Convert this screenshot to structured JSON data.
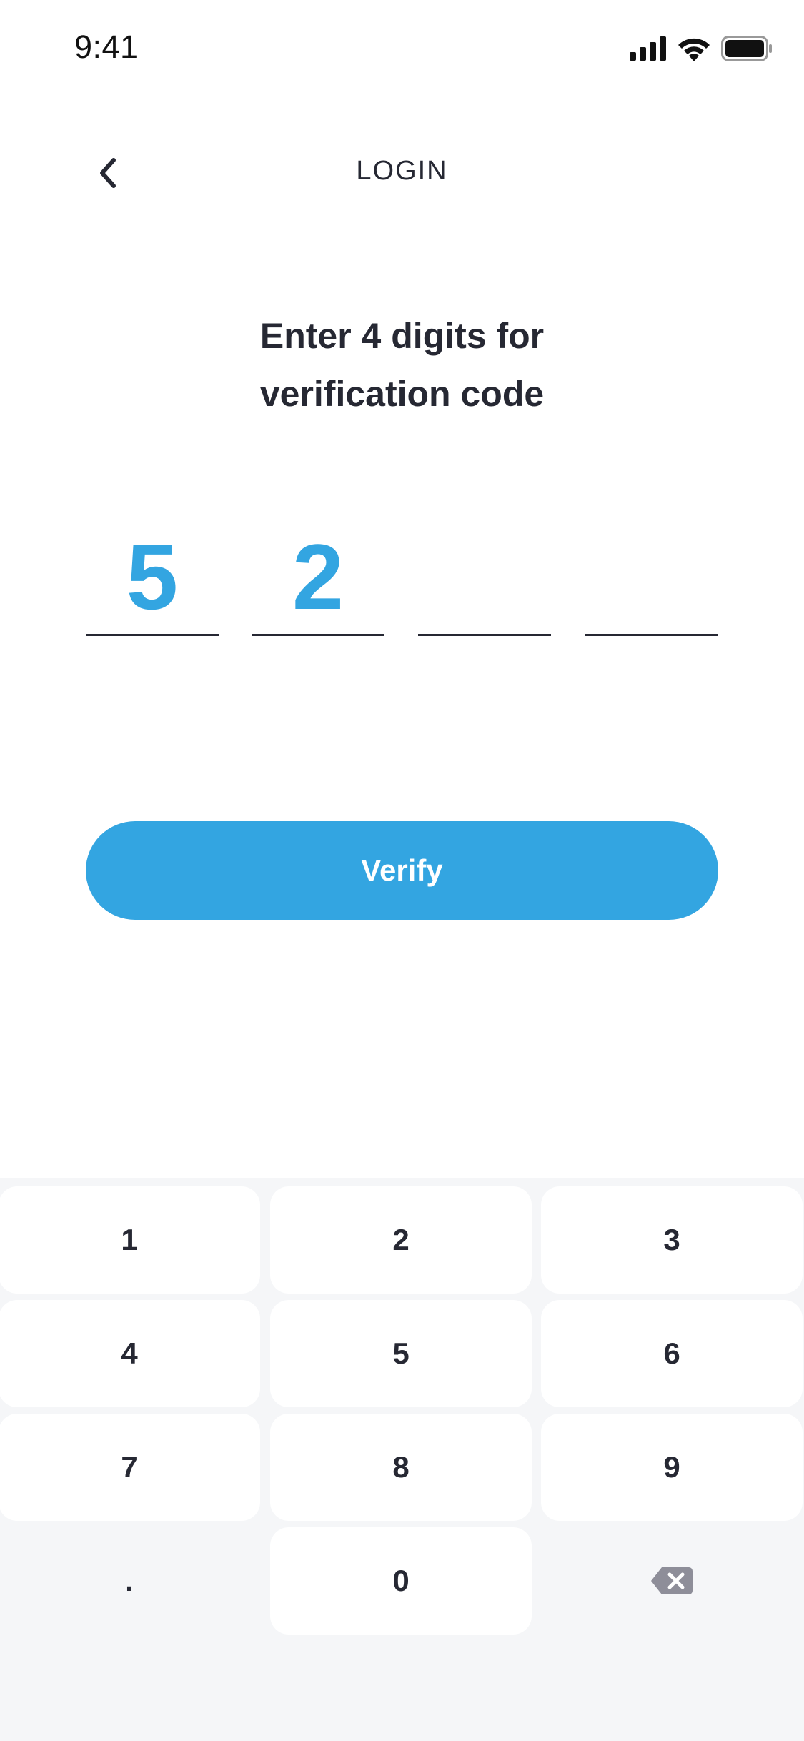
{
  "status_bar": {
    "time": "9:41",
    "icons": [
      "signal-icon",
      "wifi-icon",
      "battery-icon"
    ]
  },
  "header": {
    "back_icon": "chevron-left-icon",
    "title": "LOGIN"
  },
  "prompt": {
    "line1": "Enter 4 digits for",
    "line2": "verification code"
  },
  "code": {
    "length": 4,
    "digits": [
      "5",
      "2",
      "",
      ""
    ]
  },
  "verify_button": {
    "label": "Verify"
  },
  "keypad": {
    "keys": [
      "1",
      "2",
      "3",
      "4",
      "5",
      "6",
      "7",
      "8",
      "9",
      ".",
      "0",
      "backspace"
    ],
    "backspace_icon": "backspace-icon"
  },
  "colors": {
    "accent": "#33a5e1",
    "text": "#262833",
    "keypad_bg": "#f5f6f8",
    "key_bg": "#ffffff",
    "backspace_icon": "#8e8e99"
  }
}
